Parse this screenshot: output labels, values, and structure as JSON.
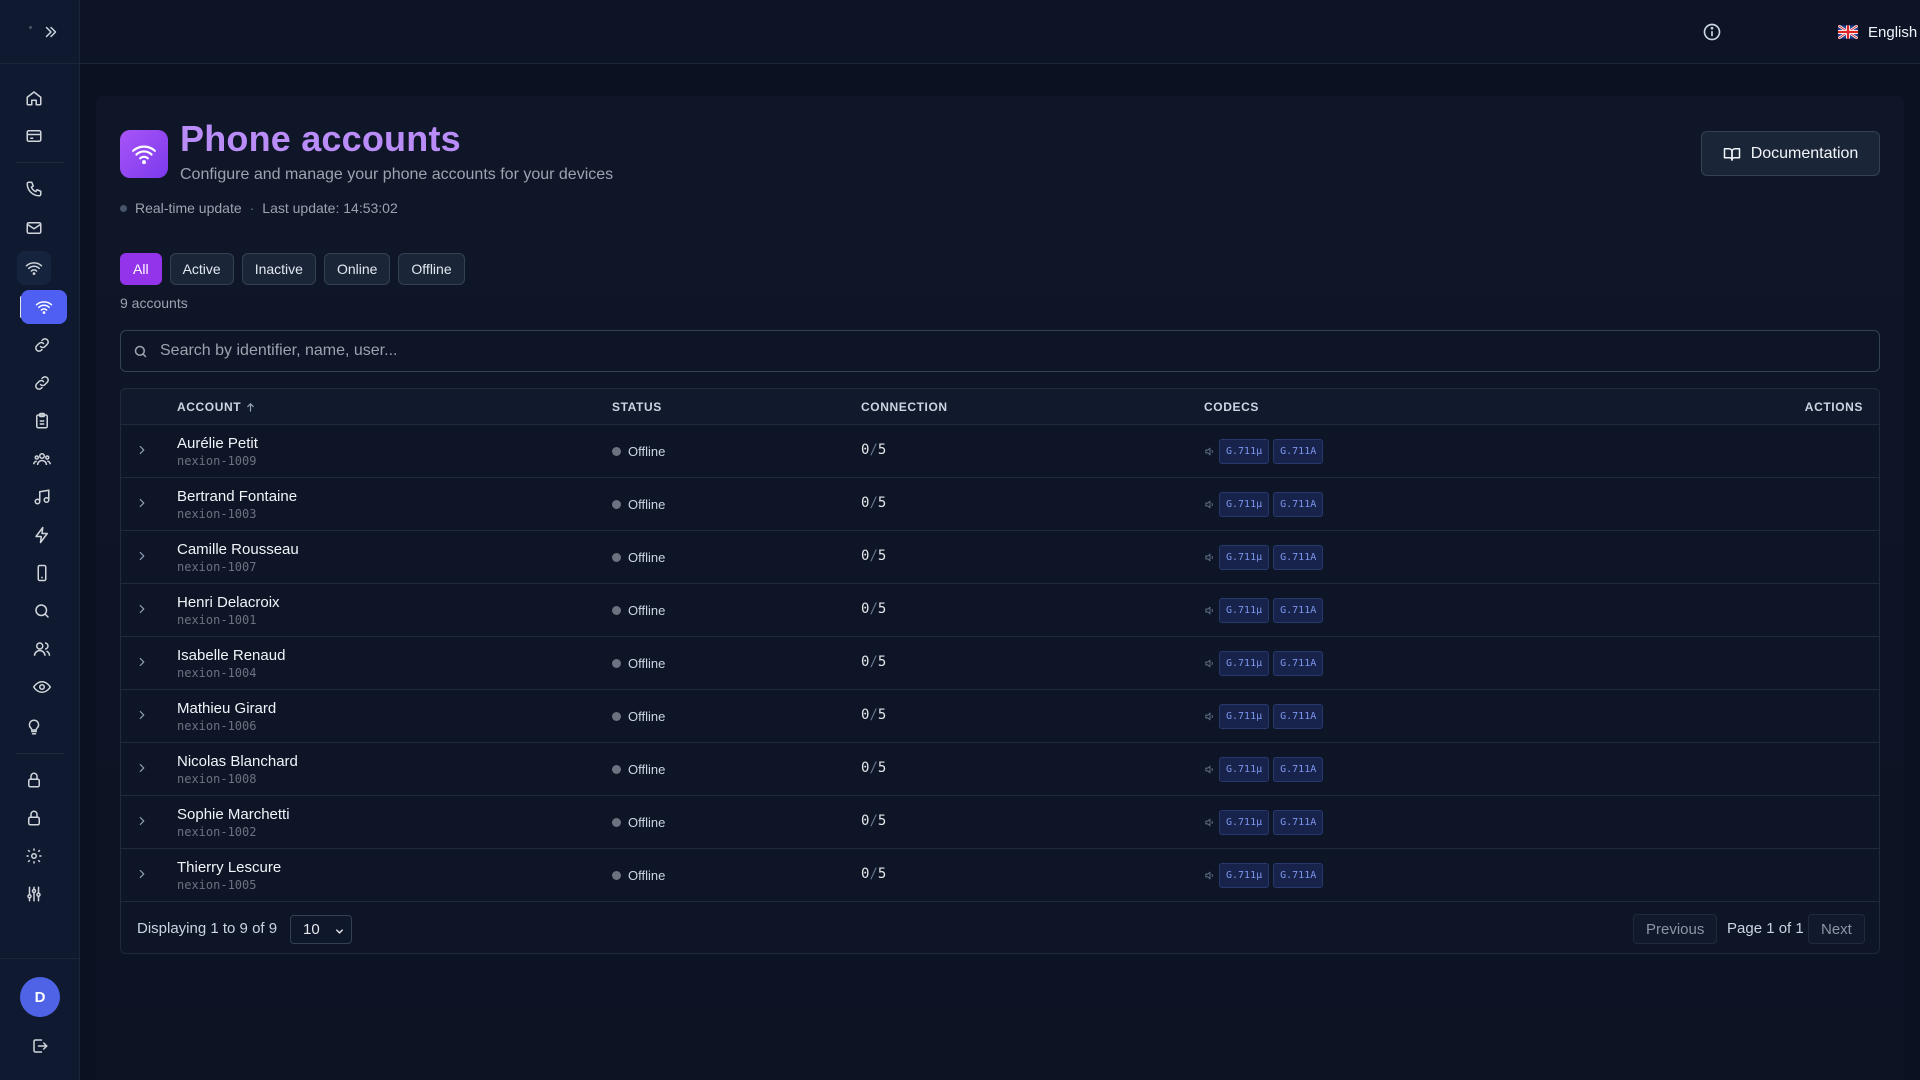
{
  "topbar": {
    "language": "English"
  },
  "header": {
    "title": "Phone accounts",
    "subtitle": "Configure and manage your phone accounts for your devices",
    "realtime": "Real-time update",
    "last_update": "Last update: 14:53:02",
    "doc_button": "Documentation"
  },
  "filters": [
    "All",
    "Active",
    "Inactive",
    "Online",
    "Offline"
  ],
  "active_filter": "All",
  "count_label": "9 accounts",
  "search": {
    "placeholder": "Search by identifier, name, user..."
  },
  "table": {
    "columns": {
      "account": "ACCOUNT",
      "status": "STATUS",
      "connection": "CONNECTION",
      "codecs": "CODECS",
      "actions": "ACTIONS"
    },
    "rows": [
      {
        "name": "Aurélie Petit",
        "id": "nexion-1009",
        "status": "Offline",
        "conn_used": "0",
        "conn_max": "5",
        "codecs": [
          "G.711µ",
          "G.711A"
        ]
      },
      {
        "name": "Bertrand Fontaine",
        "id": "nexion-1003",
        "status": "Offline",
        "conn_used": "0",
        "conn_max": "5",
        "codecs": [
          "G.711µ",
          "G.711A"
        ]
      },
      {
        "name": "Camille Rousseau",
        "id": "nexion-1007",
        "status": "Offline",
        "conn_used": "0",
        "conn_max": "5",
        "codecs": [
          "G.711µ",
          "G.711A"
        ]
      },
      {
        "name": "Henri Delacroix",
        "id": "nexion-1001",
        "status": "Offline",
        "conn_used": "0",
        "conn_max": "5",
        "codecs": [
          "G.711µ",
          "G.711A"
        ]
      },
      {
        "name": "Isabelle Renaud",
        "id": "nexion-1004",
        "status": "Offline",
        "conn_used": "0",
        "conn_max": "5",
        "codecs": [
          "G.711µ",
          "G.711A"
        ]
      },
      {
        "name": "Mathieu Girard",
        "id": "nexion-1006",
        "status": "Offline",
        "conn_used": "0",
        "conn_max": "5",
        "codecs": [
          "G.711µ",
          "G.711A"
        ]
      },
      {
        "name": "Nicolas Blanchard",
        "id": "nexion-1008",
        "status": "Offline",
        "conn_used": "0",
        "conn_max": "5",
        "codecs": [
          "G.711µ",
          "G.711A"
        ]
      },
      {
        "name": "Sophie Marchetti",
        "id": "nexion-1002",
        "status": "Offline",
        "conn_used": "0",
        "conn_max": "5",
        "codecs": [
          "G.711µ",
          "G.711A"
        ]
      },
      {
        "name": "Thierry Lescure",
        "id": "nexion-1005",
        "status": "Offline",
        "conn_used": "0",
        "conn_max": "5",
        "codecs": [
          "G.711µ",
          "G.711A"
        ]
      }
    ]
  },
  "pagination": {
    "displaying": "Displaying 1 to 9 of 9",
    "page_size": "10",
    "previous": "Previous",
    "page_info": "Page 1 of 1",
    "next": "Next"
  },
  "user": {
    "avatar_initial": "D"
  },
  "colors": {
    "accent_purple": "#9333ea",
    "title_purple": "#b98cf7",
    "active_nav": "#4f5ff2",
    "codec_text": "#7d95ee",
    "offline_dot": "#6b7280"
  }
}
